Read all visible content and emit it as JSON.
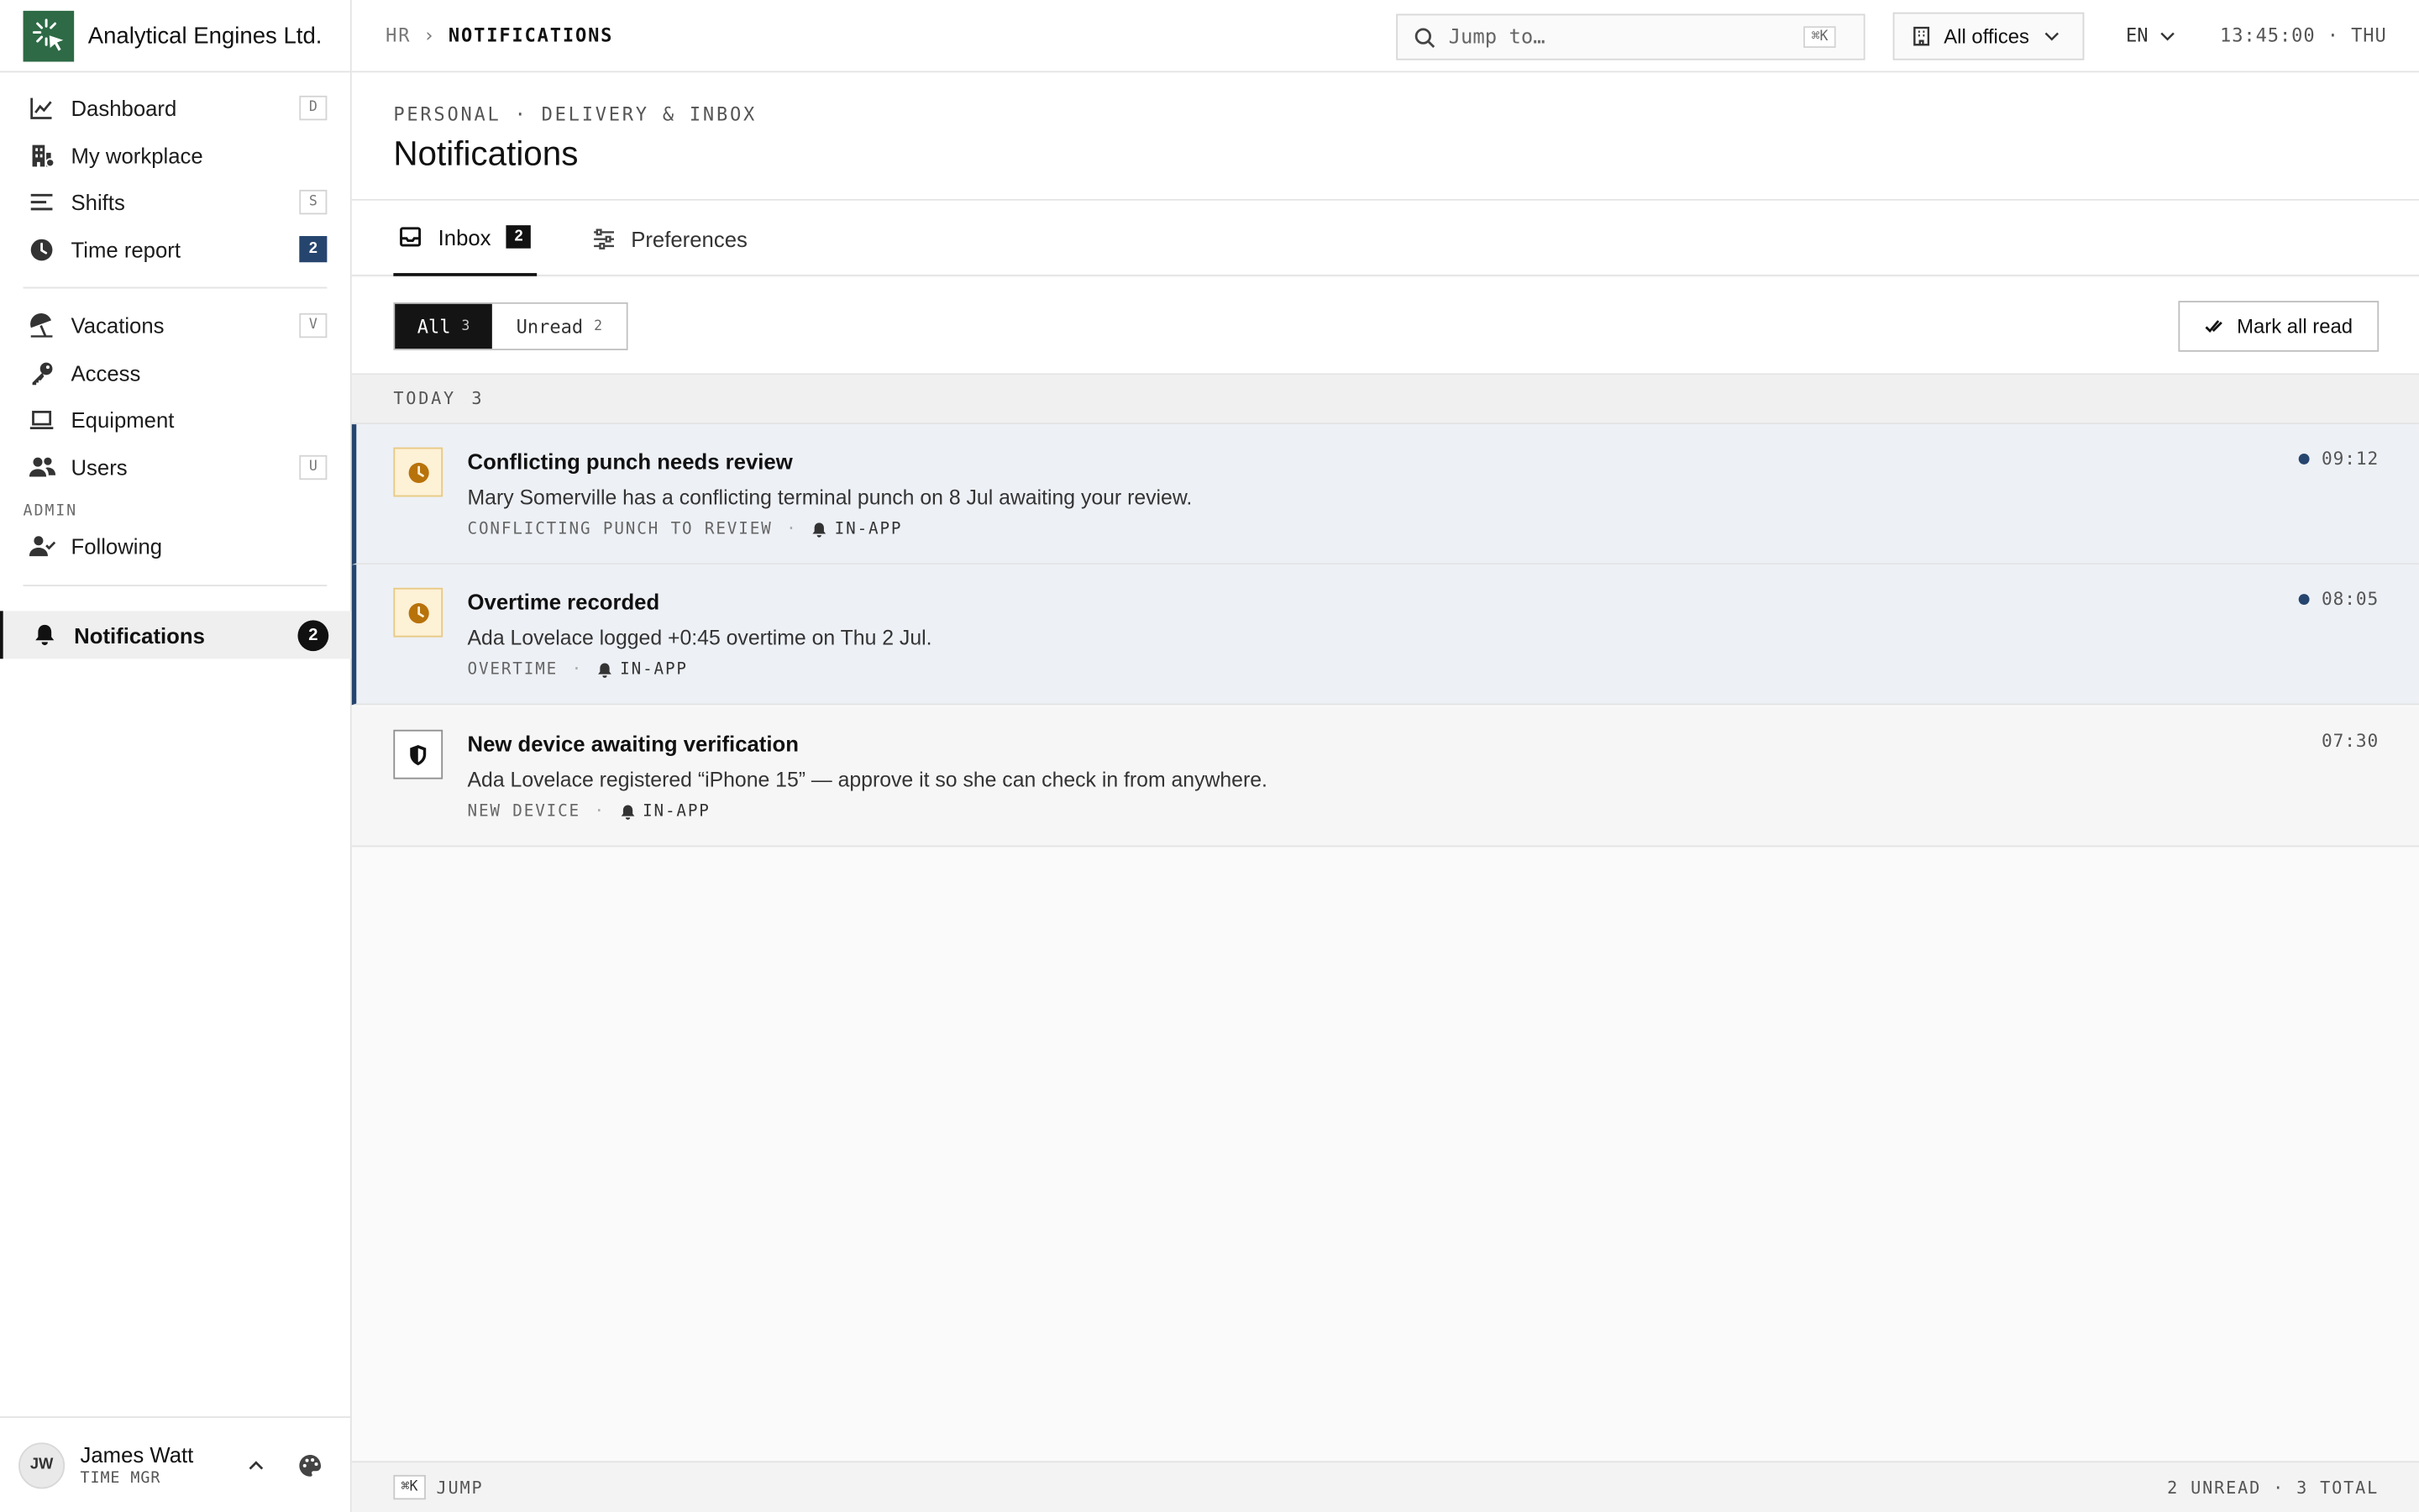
{
  "brand": {
    "name": "Analytical Engines Ltd."
  },
  "sidebar": {
    "items": [
      {
        "label": "Dashboard",
        "shortcut": "D",
        "icon": "chart-line-icon"
      },
      {
        "label": "My workplace",
        "icon": "building-icon"
      },
      {
        "label": "Shifts",
        "shortcut": "S",
        "icon": "list-icon"
      },
      {
        "label": "Time report",
        "badge": "2",
        "icon": "clock-icon"
      },
      {
        "label": "Vacations",
        "shortcut": "V",
        "icon": "umbrella-icon"
      },
      {
        "label": "Access",
        "icon": "key-icon"
      },
      {
        "label": "Equipment",
        "icon": "laptop-icon"
      },
      {
        "label": "Users",
        "shortcut": "U",
        "icon": "users-icon"
      }
    ],
    "admin_section": "ADMIN",
    "admin_items": [
      {
        "label": "Following",
        "icon": "user-check-icon"
      }
    ],
    "active": {
      "label": "Notifications",
      "badge": "2",
      "icon": "bell-icon"
    },
    "user": {
      "initials": "JW",
      "name": "James Watt",
      "role": "TIME MGR"
    }
  },
  "topbar": {
    "breadcrumb": [
      "HR",
      "NOTIFICATIONS"
    ],
    "breadcrumb_sep": "›",
    "search_placeholder": "Jump to…",
    "search_shortcut": "⌘K",
    "office": "All offices",
    "lang": "EN",
    "clock": "13:45:00 · THU"
  },
  "page": {
    "eyebrow": "PERSONAL · DELIVERY & INBOX",
    "title": "Notifications"
  },
  "tabs": {
    "inbox": {
      "label": "Inbox",
      "badge": "2"
    },
    "preferences": {
      "label": "Preferences"
    }
  },
  "filters": {
    "all": {
      "label": "All",
      "count": "3"
    },
    "unread": {
      "label": "Unread",
      "count": "2"
    },
    "mark_all": "Mark all read"
  },
  "group": {
    "label": "TODAY",
    "count": "3"
  },
  "notifications": [
    {
      "title": "Conflicting punch needs review",
      "body": "Mary Somerville has a conflicting terminal punch on 8 Jul awaiting your review.",
      "category": "CONFLICTING PUNCH TO REVIEW",
      "channel": "IN-APP",
      "time": "09:12",
      "unread": true,
      "icon": "clock-icon"
    },
    {
      "title": "Overtime recorded",
      "body": "Ada Lovelace logged +0:45 overtime on Thu 2 Jul.",
      "category": "OVERTIME",
      "channel": "IN-APP",
      "time": "08:05",
      "unread": true,
      "icon": "clock-icon"
    },
    {
      "title": "New device awaiting verification",
      "body": "Ada Lovelace registered “iPhone 15” — approve it so she can check in from anywhere.",
      "category": "NEW DEVICE",
      "channel": "IN-APP",
      "time": "07:30",
      "unread": false,
      "icon": "shield-icon"
    }
  ],
  "statusbar": {
    "shortcut": "⌘K",
    "jump": "JUMP",
    "summary": "2 UNREAD · 3 TOTAL"
  },
  "colors": {
    "brand": "#2d6a45",
    "accent": "#26456e",
    "amber": "#b8720a"
  }
}
